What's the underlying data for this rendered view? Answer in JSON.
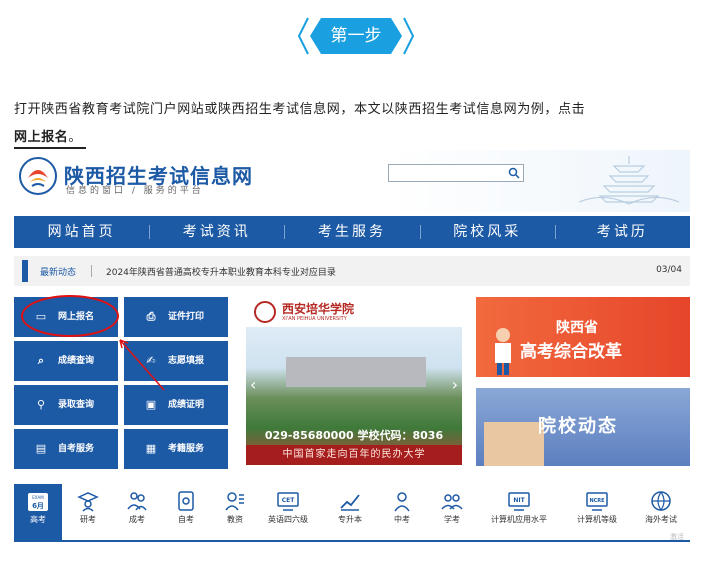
{
  "step_label": "第一步",
  "intro": {
    "text": "打开陕西省教育考试院门户网站或陕西招生考试信息网，本文以陕西招生考试信息网为例，点击",
    "bold": "网上报名",
    "end": "。"
  },
  "site": {
    "title": "陕西招生考试信息网",
    "subtitle": "信息的窗口 / 服务的平台"
  },
  "nav": [
    "网站首页",
    "考试资讯",
    "考生服务",
    "院校风采",
    "考试历"
  ],
  "news": {
    "label": "最新动态",
    "text": "2024年陕西省普通高校专升本职业教育本科专业对应目录",
    "page": "03/04"
  },
  "buttons": [
    "网上报名",
    "证件打印",
    "成绩查询",
    "志愿填报",
    "录取查询",
    "成绩证明",
    "自考服务",
    "考籍服务"
  ],
  "slide": {
    "school_cn": "西安培华学院",
    "school_en": "XI'AN PEIHUA UNIVERSITY",
    "phone": "029-85680000  学校代码：8036",
    "slogan": "中国首家走向百年的民办大学"
  },
  "banners": {
    "reform_line1": "陕西省",
    "reform_line2": "高考综合改革",
    "news_title": "院校动态"
  },
  "exam_tabs": [
    "高考",
    "研考",
    "成考",
    "自考",
    "教资",
    "英语四六级",
    "专升本",
    "中考",
    "学考",
    "计算机应用水平",
    "计算机等级",
    "海外考试"
  ],
  "exam_tab_badges": {
    "calendar_top": "EXAM",
    "calendar_num": "6月",
    "cet": "CET",
    "nit": "NIT",
    "ncre": "NCRE"
  },
  "watermark": "激活",
  "colors": {
    "brand": "#1d5aa6",
    "accent": "#1a9fe0",
    "highlight": "#e01010"
  }
}
